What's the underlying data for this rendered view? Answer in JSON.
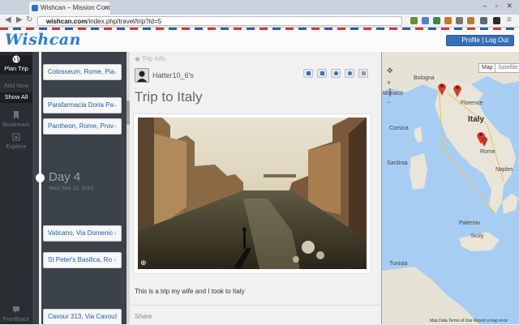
{
  "browser": {
    "tab_title": "Wishcan – Mission Control",
    "tab_close": "×",
    "url_domain": "wishcan.com",
    "url_path": "/index.php/travel/trip?id=5"
  },
  "header": {
    "logo": "Wishcan",
    "profile_label": "Profile | Log Out"
  },
  "rail": {
    "items": [
      {
        "label": "Plan Trip",
        "icon": "globe-icon"
      },
      {
        "label": "Add New"
      },
      {
        "label": "Show All"
      },
      {
        "label": "Bookmark",
        "icon": "bookmark-icon"
      },
      {
        "label": "Explore",
        "icon": "compass-icon"
      },
      {
        "label": "Feedback",
        "icon": "chat-icon"
      }
    ]
  },
  "timeline": {
    "stops_top": [
      "Colosseum, Rome, Pia",
      "Parafarmacia Doria Pa",
      "Pantheon, Rome, Prov"
    ],
    "day": {
      "title": "Day 4",
      "date": "Wed, Mar 21, 2012"
    },
    "stops_bottom": [
      "Vaticano, Via Domenic",
      "St Peter's Basilica, Ro",
      "Cavour 313, Via Cavou"
    ]
  },
  "info": {
    "section_label": "Trip Info",
    "username": "Hatter10_6's",
    "title": "Trip to Italy",
    "description": "This is a trip my wife and I took to Italy",
    "share_label": "Share",
    "tools": [
      "edit-icon",
      "image-icon",
      "settings-icon",
      "delete-icon",
      "trash-icon"
    ]
  },
  "map": {
    "type_map": "Map",
    "type_satellite": "Satellite",
    "labels": {
      "country": "Italy",
      "bologna": "Bologna",
      "florence": "Florence",
      "rome": "Rome",
      "naples": "Naples",
      "sardinia": "Sardinia",
      "corsica": "Corsica",
      "monaco": "Monaco",
      "sicily": "Sicily",
      "palermo": "Palermo",
      "tunisia": "Tunisia",
      "footer": "Map Data   Terms of Use   Report a map error"
    }
  },
  "colors": {
    "brand": "#2a7bd0",
    "rail_bg": "#2a2e33",
    "timeline_bg": "#3c424a",
    "marker": "#d93a2e"
  }
}
